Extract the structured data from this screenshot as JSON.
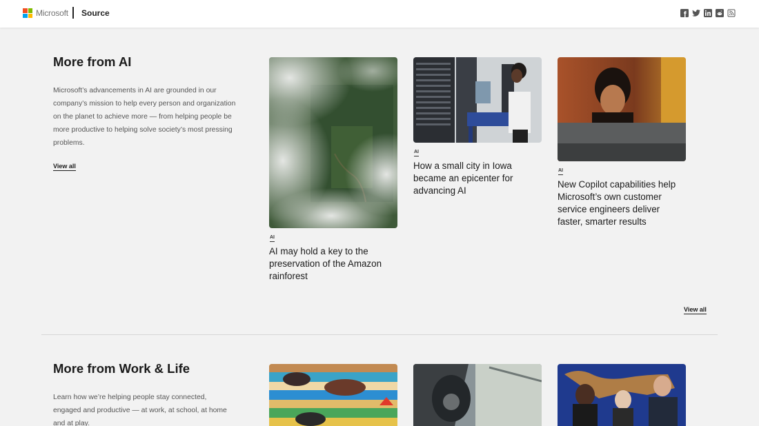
{
  "header": {
    "brand": "Microsoft",
    "site": "Source",
    "logo_colors": [
      "#f25022",
      "#7fba00",
      "#00a4ef",
      "#ffb900"
    ],
    "social_icons": [
      "facebook-icon",
      "twitter-icon",
      "linkedin-icon",
      "reddit-icon",
      "rss-icon"
    ]
  },
  "sections": [
    {
      "title": "More from AI",
      "description": "Microsoft’s advancements in AI are grounded in our company’s mission to help every person and organization on the planet to achieve more — from helping people be more productive to helping solve society’s most pressing problems.",
      "view_all_top": "View all",
      "view_all_bottom": "View all",
      "cards": [
        {
          "tag": "AI",
          "title": "AI may hold a key to the preservation of the Amazon rainforest",
          "image": "aerial-rainforest-clouds"
        },
        {
          "tag": "AI",
          "title": "How a small city in Iowa became an epicenter for advancing AI",
          "image": "woman-in-datacenter"
        },
        {
          "tag": "AI",
          "title": "New Copilot capabilities help Microsoft’s own customer service engineers deliver faster, smarter results",
          "image": "woman-at-monitor"
        }
      ]
    },
    {
      "title": "More from Work & Life",
      "description": "Learn how we’re helping people stay connected, engaged and productive — at work, at school, at home and at play.",
      "cards": [
        {
          "image": "colorful-mural"
        },
        {
          "image": "pilot-helmet-cockpit"
        },
        {
          "image": "three-people-world-map"
        }
      ]
    }
  ]
}
